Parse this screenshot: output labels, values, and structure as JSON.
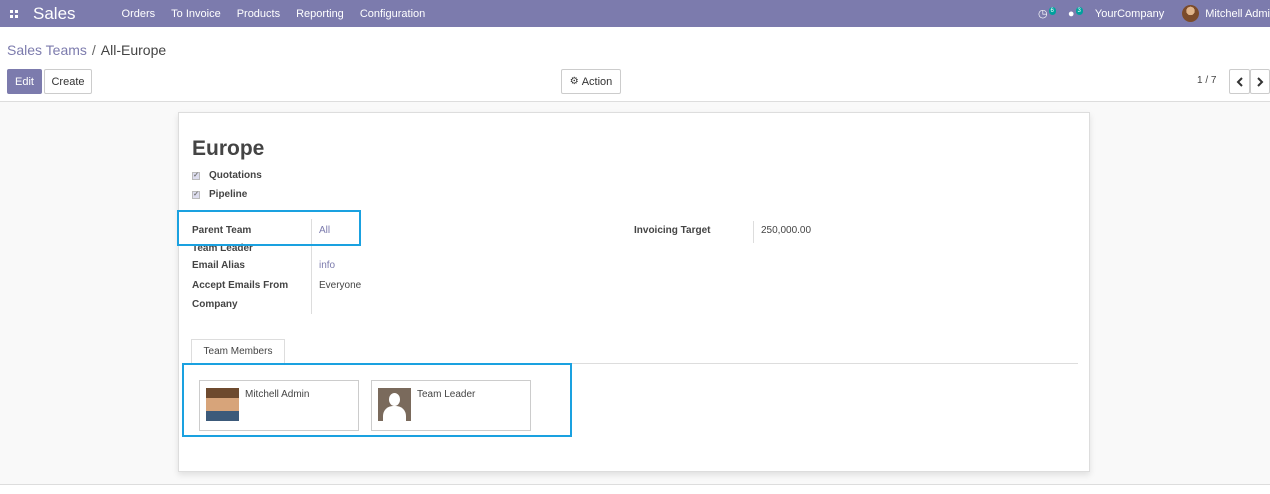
{
  "navbar": {
    "app_name": "Sales",
    "menu": [
      "Orders",
      "To Invoice",
      "Products",
      "Reporting",
      "Configuration"
    ],
    "activity_badge": "6",
    "messages_badge": "3",
    "company": "YourCompany",
    "user": "Mitchell Admi",
    "icons": {
      "apps": "apps-grid-icon",
      "activity": "clock-icon",
      "messages": "chat-icon"
    },
    "colors": {
      "navbar": "#7c7bad",
      "badge": "#00a09d",
      "highlight": "#1aa1e0"
    }
  },
  "breadcrumb": {
    "parent": "Sales Teams",
    "current": "All-Europe"
  },
  "buttons": {
    "edit": "Edit",
    "create": "Create",
    "action": "Action"
  },
  "pager": {
    "value": "1 / 7"
  },
  "form": {
    "title": "Europe",
    "checks": [
      "Quotations",
      "Pipeline"
    ],
    "fields": {
      "parent_team_label": "Parent Team",
      "parent_team_value": "All",
      "team_leader_label": "Team Leader",
      "email_alias_label": "Email Alias",
      "email_alias_value": "info",
      "accept_label_1": "Accept Emails From",
      "accept_label_2": "Company",
      "accept_value": "Everyone",
      "invoicing_label": "Invoicing Target",
      "invoicing_value": "250,000.00"
    },
    "tab": "Team Members",
    "members": [
      "Mitchell Admin",
      "Team Leader"
    ]
  }
}
